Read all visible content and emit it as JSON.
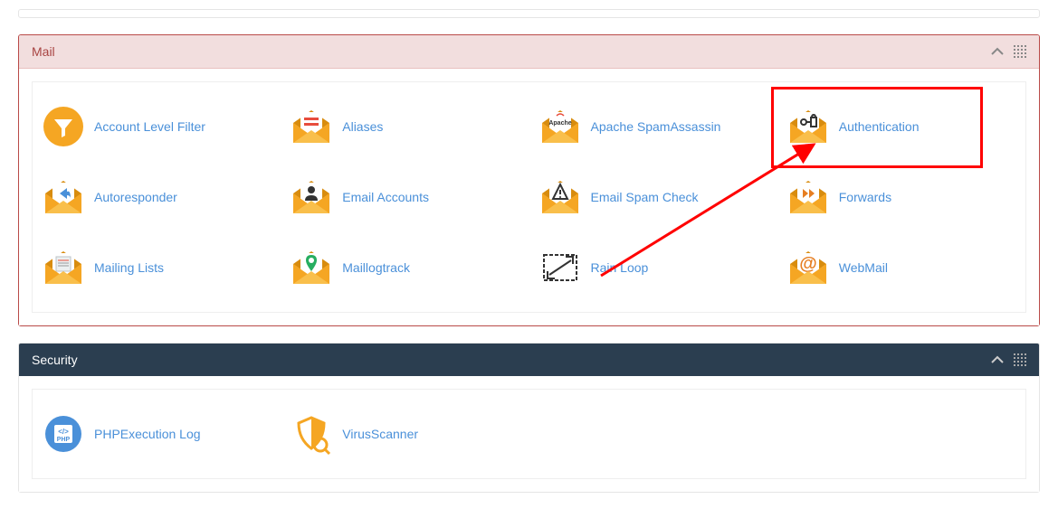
{
  "panels": {
    "mail": {
      "title": "Mail",
      "items": [
        {
          "label": "Account Level Filter",
          "name": "account-level-filter",
          "icon": "funnel"
        },
        {
          "label": "Aliases",
          "name": "aliases",
          "icon": "aliases"
        },
        {
          "label": "Apache SpamAssassin",
          "name": "apache-spamassassin",
          "icon": "apache"
        },
        {
          "label": "Authentication",
          "name": "authentication",
          "icon": "lock"
        },
        {
          "label": "Autoresponder",
          "name": "autoresponder",
          "icon": "reply"
        },
        {
          "label": "Email Accounts",
          "name": "email-accounts",
          "icon": "person"
        },
        {
          "label": "Email Spam Check",
          "name": "email-spam-check",
          "icon": "warning"
        },
        {
          "label": "Forwards",
          "name": "forwards",
          "icon": "forward"
        },
        {
          "label": "Mailing Lists",
          "name": "mailing-lists",
          "icon": "list"
        },
        {
          "label": "Maillogtrack",
          "name": "maillogtrack",
          "icon": "pin"
        },
        {
          "label": "Rain Loop",
          "name": "rain-loop",
          "icon": "rainloop"
        },
        {
          "label": "WebMail",
          "name": "webmail",
          "icon": "at"
        }
      ]
    },
    "security": {
      "title": "Security",
      "items": [
        {
          "label": "PHPExecution Log",
          "name": "phpexecution-log",
          "icon": "php"
        },
        {
          "label": "VirusScanner",
          "name": "virus-scanner",
          "icon": "shield"
        }
      ]
    }
  },
  "highlight": {
    "target": "authentication"
  },
  "colors": {
    "link": "#4a90d9",
    "mailBorder": "#b94a48",
    "mailHeaderBg": "#f2dede",
    "securityHeaderBg": "#2b3e50",
    "highlight": "#ff0000"
  }
}
